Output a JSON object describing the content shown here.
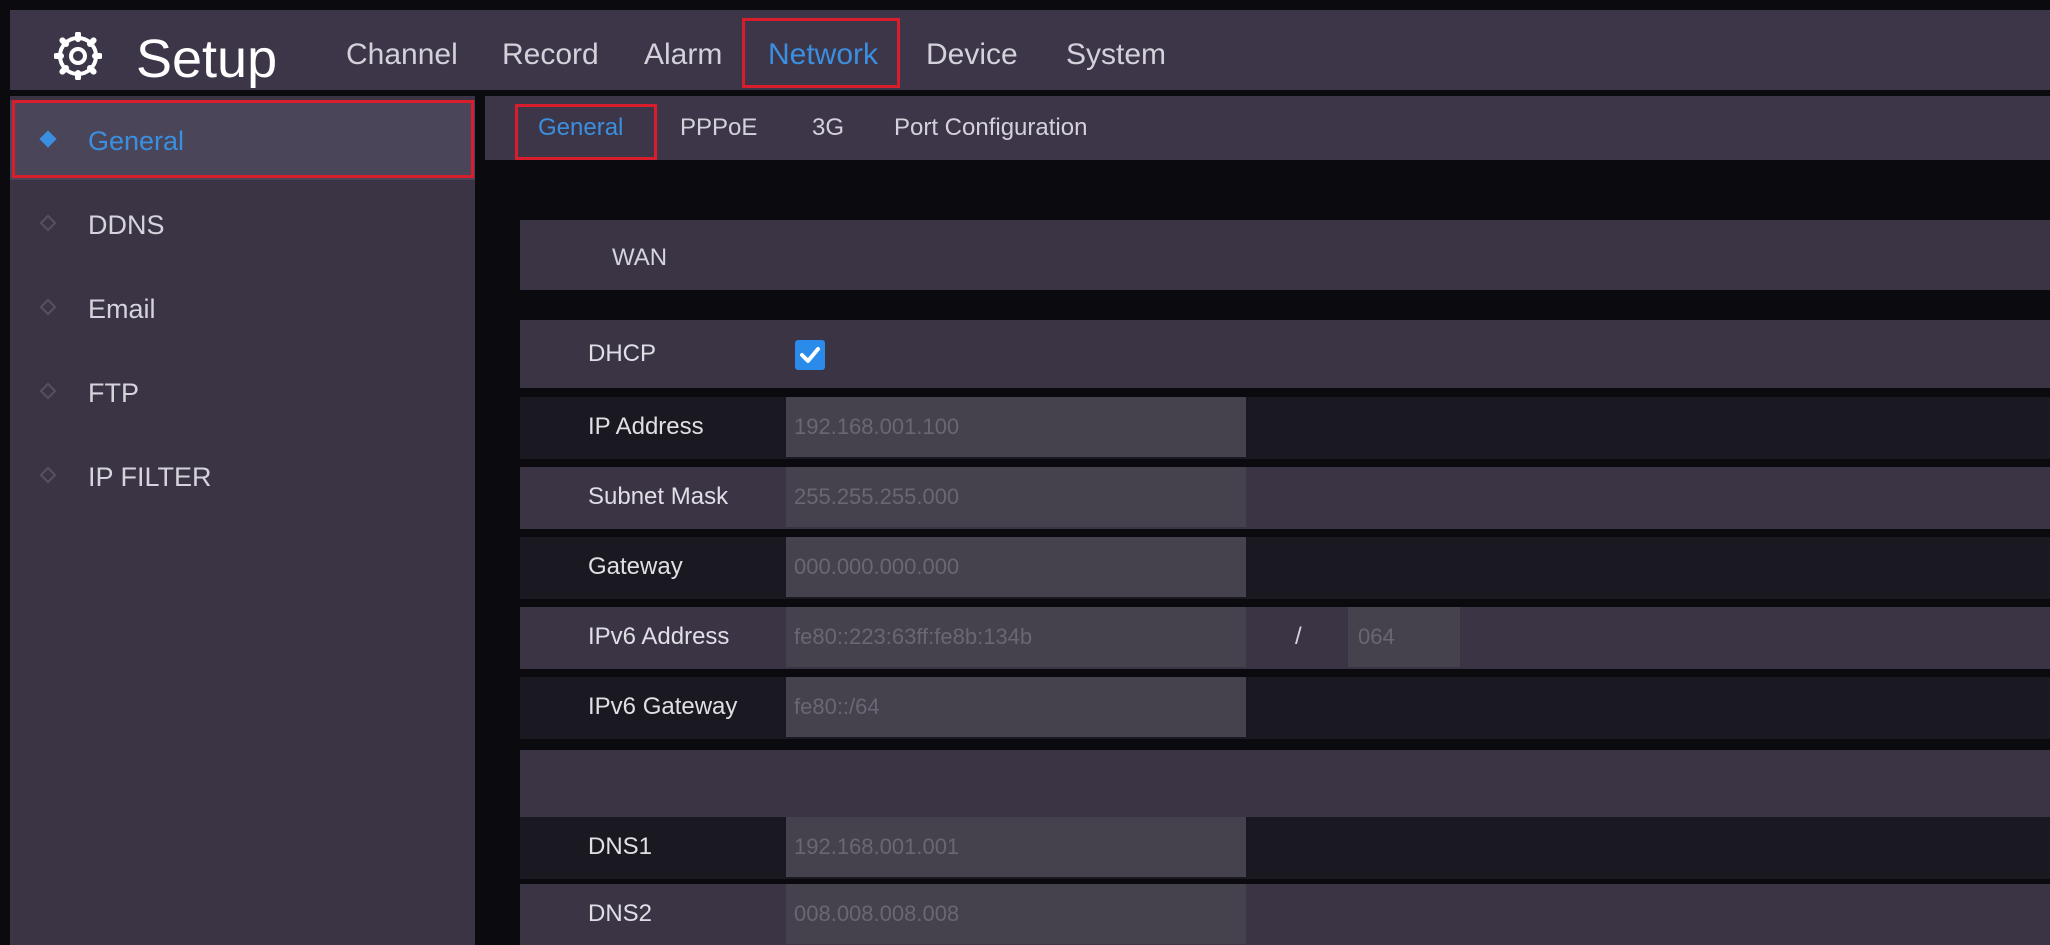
{
  "app": {
    "title": "Setup",
    "icon": "gear-icon"
  },
  "top_menu": [
    {
      "label": "Channel",
      "active": false
    },
    {
      "label": "Record",
      "active": false
    },
    {
      "label": "Alarm",
      "active": false
    },
    {
      "label": "Network",
      "active": true
    },
    {
      "label": "Device",
      "active": false
    },
    {
      "label": "System",
      "active": false
    }
  ],
  "sidebar": {
    "items": [
      {
        "label": "General",
        "active": true
      },
      {
        "label": "DDNS",
        "active": false
      },
      {
        "label": "Email",
        "active": false
      },
      {
        "label": "FTP",
        "active": false
      },
      {
        "label": "IP FILTER",
        "active": false
      }
    ]
  },
  "sub_tabs": [
    {
      "label": "General",
      "active": true
    },
    {
      "label": "PPPoE",
      "active": false
    },
    {
      "label": "3G",
      "active": false
    },
    {
      "label": "Port Configuration",
      "active": false
    }
  ],
  "wan": {
    "section_title": "WAN",
    "dhcp_label": "DHCP",
    "dhcp_checked": true,
    "ip_address_label": "IP Address",
    "ip_address": "192.168.001.100",
    "subnet_mask_label": "Subnet Mask",
    "subnet_mask": "255.255.255.000",
    "gateway_label": "Gateway",
    "gateway": "000.000.000.000",
    "ipv6_address_label": "IPv6 Address",
    "ipv6_address": "fe80::223:63ff:fe8b:134b",
    "ipv6_separator": "/",
    "ipv6_prefix": "064",
    "ipv6_gateway_label": "IPv6 Gateway",
    "ipv6_gateway": "fe80::/64",
    "dns1_label": "DNS1",
    "dns1": "192.168.001.001",
    "dns2_label": "DNS2",
    "dns2": "008.008.008.008"
  },
  "colors": {
    "accent": "#3b8fe0",
    "highlight_box": "#d81e2c",
    "bar_bg": "#3d3649",
    "panel_bg": "#3a3445"
  }
}
